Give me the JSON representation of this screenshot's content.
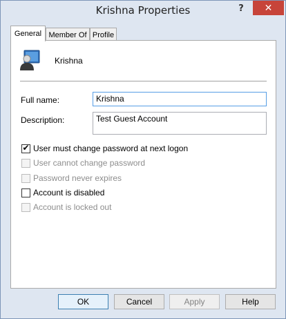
{
  "window": {
    "title": "Krishna Properties",
    "help_label": "?",
    "close_label": "✕"
  },
  "tabs": [
    {
      "label": "General",
      "active": true
    },
    {
      "label": "Member Of",
      "active": false
    },
    {
      "label": "Profile",
      "active": false
    }
  ],
  "general": {
    "username": "Krishna",
    "full_name_label": "Full name:",
    "full_name_value": "Krishna",
    "description_label": "Description:",
    "description_value": "Test Guest Account",
    "options": [
      {
        "label": "User must change password at next logon",
        "checked": true,
        "enabled": true
      },
      {
        "label": "User cannot change password",
        "checked": false,
        "enabled": false
      },
      {
        "label": "Password never expires",
        "checked": false,
        "enabled": false
      },
      {
        "label": "Account is disabled",
        "checked": false,
        "enabled": true
      },
      {
        "label": "Account is locked out",
        "checked": false,
        "enabled": false
      }
    ]
  },
  "buttons": {
    "ok": "OK",
    "cancel": "Cancel",
    "apply": "Apply",
    "help": "Help"
  },
  "colors": {
    "accent_close": "#c7443a",
    "window_frame": "#dee6f1",
    "focus_border": "#569de5"
  }
}
